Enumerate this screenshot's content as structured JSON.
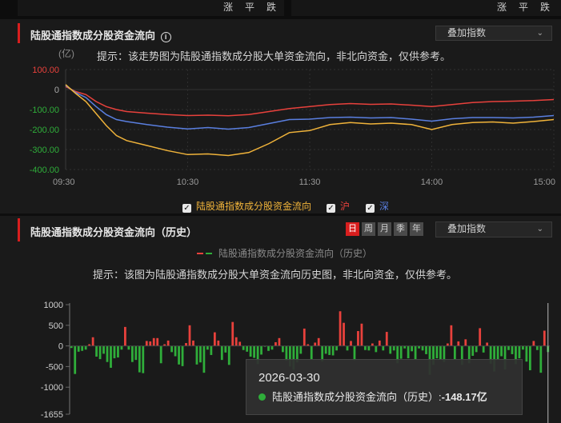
{
  "top_strip": {
    "left_labels": [
      "涨",
      "平",
      "跌"
    ],
    "right_labels": [
      "涨",
      "平",
      "跌"
    ]
  },
  "intraday": {
    "title": "陆股通指数成分股资金流向",
    "info_icon": "info-icon",
    "overlay_select": "叠加指数",
    "hint": "提示：该走势图为陆股通指数成分股大单资金流向，非北向资金，仅供参考。",
    "unit": "(亿)",
    "legend": [
      {
        "label": "陆股通指数成分股资金流向",
        "color": "#f0b33a",
        "checked": true
      },
      {
        "label": "沪",
        "color": "#e8413c",
        "checked": true
      },
      {
        "label": "深",
        "color": "#5a7fe0",
        "checked": true
      }
    ]
  },
  "history": {
    "title": "陆股通指数成分股资金流向（历史）",
    "overlay_select": "叠加指数",
    "periods": [
      "日",
      "周",
      "月",
      "季",
      "年"
    ],
    "active_period": "日",
    "legend_label": "陆股通指数成分股资金流向（历史）",
    "hint": "提示：该图为陆股通指数成分股大单资金流向历史图，非北向资金，仅供参考。",
    "tooltip": {
      "date": "2026-03-30",
      "series": "陆股通指数成分股资金流向（历史）",
      "value": "-148.17亿"
    }
  },
  "chart_data": [
    {
      "type": "line",
      "title": "陆股通指数成分股资金流向",
      "ylabel": "(亿)",
      "ylim": [
        -400,
        100
      ],
      "yticks": [
        "100.00",
        "0",
        "-100.00",
        "-200.00",
        "-300.00",
        "-400.00"
      ],
      "xticks": [
        "09:30",
        "10:30",
        "11:30",
        "14:00",
        "15:00"
      ],
      "x": [
        "09:30",
        "09:35",
        "09:40",
        "09:45",
        "09:50",
        "09:55",
        "10:00",
        "10:10",
        "10:20",
        "10:30",
        "10:40",
        "10:50",
        "11:00",
        "11:10",
        "11:20",
        "11:30",
        "13:10",
        "13:20",
        "13:30",
        "13:40",
        "13:50",
        "14:00",
        "14:10",
        "14:20",
        "14:30",
        "14:40",
        "14:50",
        "15:00"
      ],
      "series": [
        {
          "name": "陆股通指数成分股资金流向",
          "color": "#f0b33a",
          "values": [
            25,
            -20,
            -60,
            -120,
            -180,
            -230,
            -255,
            -280,
            -305,
            -325,
            -322,
            -330,
            -315,
            -270,
            -215,
            -205,
            -175,
            -165,
            -172,
            -168,
            -175,
            -200,
            -175,
            -165,
            -162,
            -168,
            -160,
            -150
          ]
        },
        {
          "name": "深",
          "color": "#5a7fe0",
          "values": [
            20,
            -15,
            -40,
            -85,
            -125,
            -150,
            -160,
            -175,
            -188,
            -197,
            -190,
            -198,
            -190,
            -170,
            -150,
            -148,
            -140,
            -138,
            -142,
            -140,
            -148,
            -158,
            -146,
            -140,
            -140,
            -142,
            -138,
            -130
          ]
        },
        {
          "name": "沪",
          "color": "#e8413c",
          "values": [
            15,
            -10,
            -25,
            -60,
            -85,
            -100,
            -110,
            -118,
            -125,
            -130,
            -128,
            -131,
            -125,
            -110,
            -95,
            -85,
            -75,
            -70,
            -74,
            -72,
            -78,
            -85,
            -75,
            -65,
            -60,
            -58,
            -55,
            -50
          ]
        }
      ]
    },
    {
      "type": "bar",
      "title": "陆股通指数成分股资金流向（历史）",
      "ylim": [
        -1655,
        1000
      ],
      "yticks": [
        "1000",
        "500",
        "0",
        "-500",
        "-1000",
        "-1655"
      ],
      "values": [
        -50,
        -680,
        -140,
        -120,
        -90,
        40,
        210,
        -260,
        -320,
        -190,
        -390,
        -530,
        -300,
        -280,
        -90,
        460,
        -90,
        -390,
        -340,
        -640,
        -660,
        120,
        110,
        190,
        190,
        -420,
        40,
        130,
        -150,
        -250,
        -450,
        -490,
        70,
        500,
        130,
        -450,
        -400,
        -650,
        -90,
        -220,
        330,
        130,
        -340,
        -160,
        -460,
        580,
        210,
        100,
        -100,
        -140,
        -260,
        -290,
        -440,
        -210,
        -20,
        -120,
        -90,
        90,
        190,
        -150,
        -360,
        -500,
        -580,
        -400,
        -190,
        420,
        40,
        -340,
        80,
        190,
        -380,
        -190,
        -220,
        -230,
        -110,
        840,
        560,
        -110,
        120,
        -350,
        360,
        540,
        -100,
        -110,
        60,
        -150,
        130,
        -110,
        340,
        -190,
        -110,
        -420,
        -310,
        -60,
        -300,
        -130,
        -340,
        -60,
        -110,
        -200,
        -700,
        -460,
        -300,
        -320,
        -390,
        60,
        500,
        -320,
        110,
        -460,
        160,
        -420,
        -240,
        -150,
        430,
        -160,
        80,
        -430,
        -620,
        -330,
        -250,
        -570,
        -100,
        -200,
        -440,
        -300,
        -90,
        -380,
        -590,
        120,
        -100,
        -650,
        370,
        -148
      ]
    }
  ]
}
